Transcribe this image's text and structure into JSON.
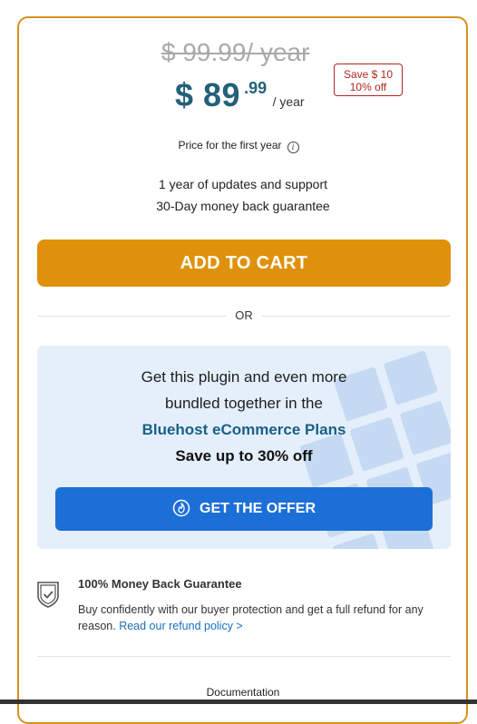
{
  "pricing": {
    "old_price": "$ 99.99/ year",
    "price_main": "$ 89",
    "price_cents": ".99",
    "price_period": "/ year",
    "save_line1": "Save $ 10",
    "save_line2": "10% off",
    "first_year_note": "Price for the first year",
    "benefits": [
      "1 year of updates and support",
      "30-Day money back guarantee"
    ],
    "add_to_cart_label": "ADD TO CART",
    "or_label": "OR"
  },
  "offer": {
    "line1": "Get this plugin and even more",
    "line2": "bundled together in the",
    "plan_name": "Bluehost eCommerce Plans",
    "save_text": "Save up to 30% off",
    "button_label": "GET THE OFFER"
  },
  "guarantee": {
    "title": "100% Money Back Guarantee",
    "text": "Buy confidently with our buyer protection and get a full refund for any reason.",
    "link_text": "Read our refund policy >"
  },
  "footer": {
    "documentation_label": "Documentation"
  },
  "colors": {
    "accent": "#e0910b",
    "price": "#23617a",
    "offer_button": "#1d6fd8",
    "badge": "#b3261e"
  }
}
